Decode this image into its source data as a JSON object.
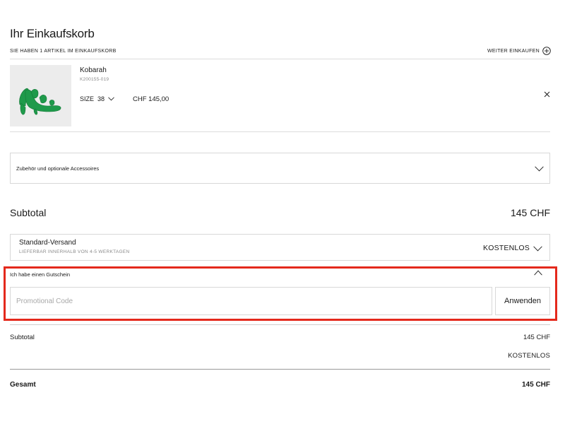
{
  "page": {
    "title": "Ihr Einkaufskorb",
    "items_count": "SIE HABEN 1 ARTIKEL IM EINKAUFSKORB",
    "continue_shopping": "WEITER EINKAUFEN"
  },
  "product": {
    "name": "Kobarah",
    "sku": "K200155-019",
    "size_label": "SIZE",
    "size_value": "38",
    "price": "CHF 145,00",
    "image_color": "#1f9a4b",
    "remove_icon": "close-icon"
  },
  "accessories": {
    "label": "Zubehör und optionale Accessoires"
  },
  "subtotal_header": {
    "label": "Subtotal",
    "amount": "145 CHF"
  },
  "shipping": {
    "name": "Standard-Versand",
    "delivery": "LIEFERBAR INNERHALB VON 4-5 WERKTAGEN",
    "price": "KOSTENLOS"
  },
  "voucher": {
    "label": "Ich habe einen Gutschein",
    "placeholder": "Promotional Code",
    "value": "",
    "apply_label": "Anwenden",
    "highlight_color": "#e4291c"
  },
  "summary": {
    "subtotal_label": "Subtotal",
    "subtotal_value": "145 CHF",
    "shipping_value": "KOSTENLOS",
    "total_label": "Gesamt",
    "total_value": "145 CHF"
  }
}
